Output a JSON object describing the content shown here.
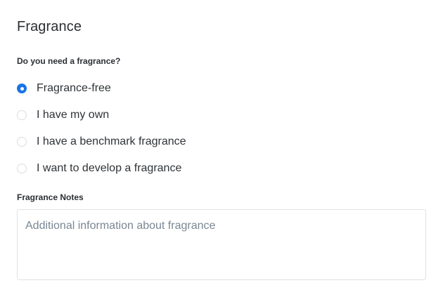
{
  "section": {
    "title": "Fragrance"
  },
  "question": {
    "label": "Do you need a fragrance?",
    "options": [
      {
        "label": "Fragrance-free",
        "checked": true
      },
      {
        "label": "I have my own",
        "checked": false
      },
      {
        "label": "I have a benchmark fragrance",
        "checked": false
      },
      {
        "label": "I want to develop a fragrance",
        "checked": false
      }
    ]
  },
  "notes": {
    "label": "Fragrance Notes",
    "placeholder": "Additional information about fragrance",
    "value": ""
  },
  "colors": {
    "accent": "#1a73e8",
    "radio_border": "#d9dde2",
    "placeholder": "#7a8794"
  }
}
